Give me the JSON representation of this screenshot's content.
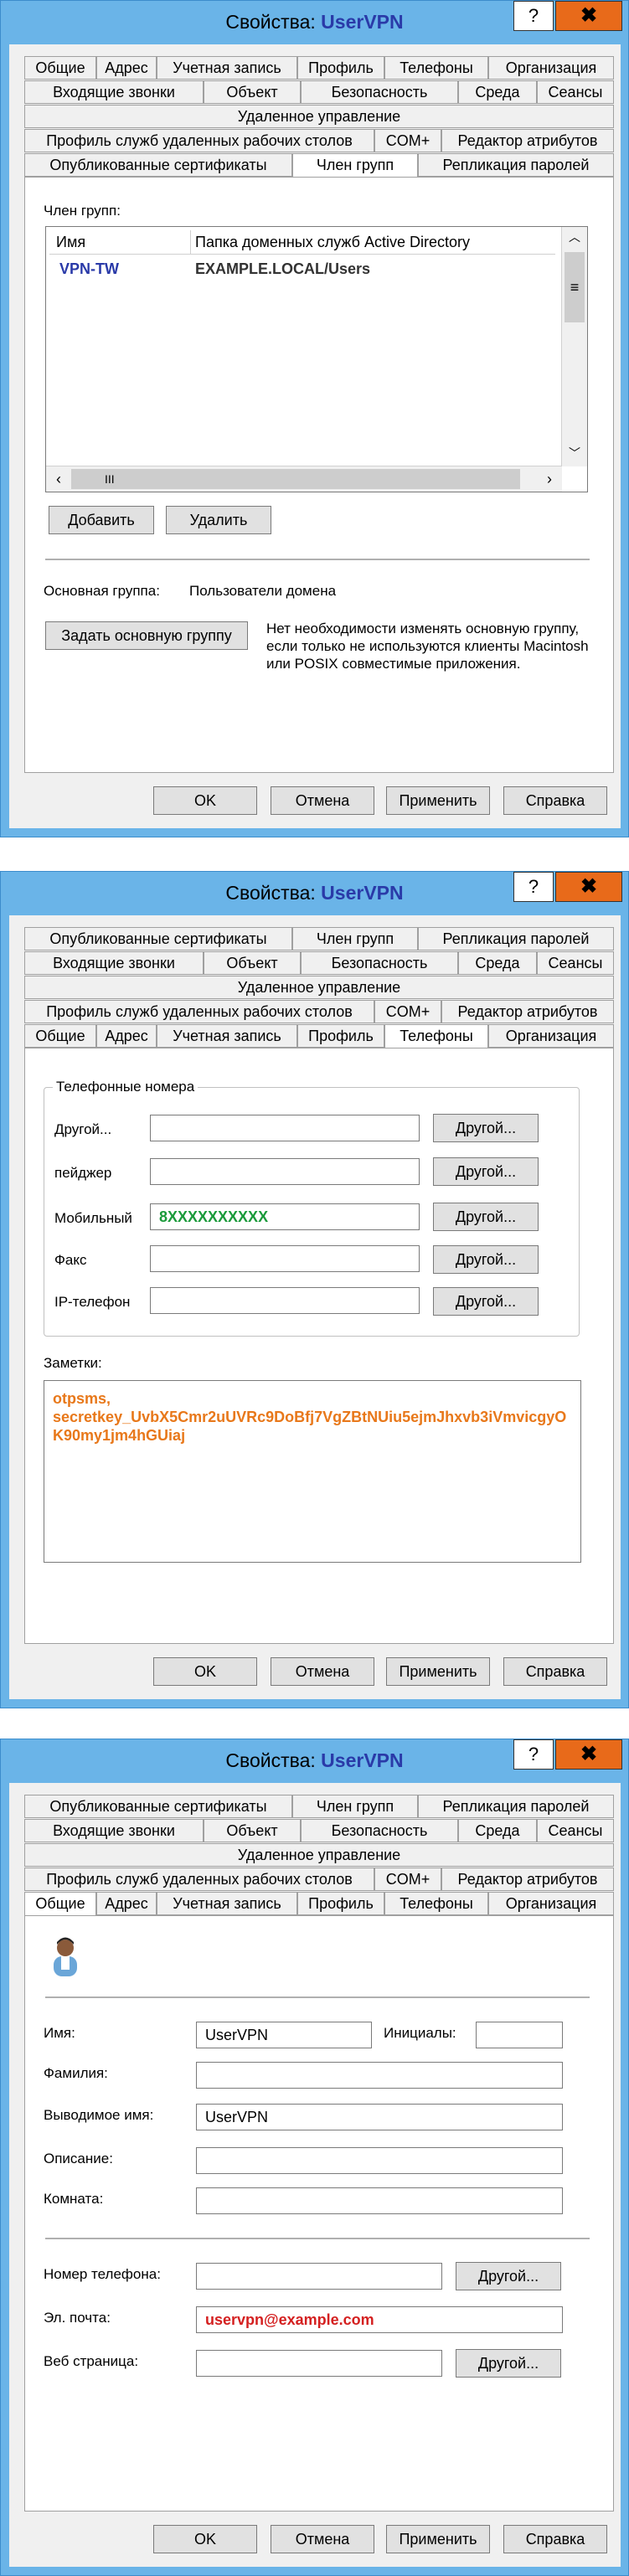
{
  "title_prefix": "Свойства:",
  "title_user": "UserVPN",
  "help_label": "?",
  "close_label": "✖",
  "tabs": {
    "obshchie": "Общие",
    "adres": "Адрес",
    "uchetnaya": "Учетная запись",
    "profil": "Профиль",
    "telefony": "Телефоны",
    "organizaciya": "Организация",
    "vhodyashchie": "Входящие звонки",
    "obekt": "Объект",
    "bezopasnost": "Безопасность",
    "sreda": "Среда",
    "seansy": "Сеансы",
    "udalennoe": "Удаленное управление",
    "profil_sluzhb": "Профиль служб удаленных рабочих столов",
    "com": "COM+",
    "redaktor": "Редактор атрибутов",
    "opublikovannye": "Опубликованные сертификаты",
    "chlen_grupp": "Член групп",
    "replikaciya": "Репликация паролей"
  },
  "footer": {
    "ok": "OK",
    "cancel": "Отмена",
    "apply": "Применить",
    "help": "Справка"
  },
  "groups": {
    "section_label": "Член групп:",
    "col_name": "Имя",
    "col_folder": "Папка доменных служб Active Directory",
    "rows": [
      {
        "name": "VPN-TW",
        "folder": "EXAMPLE.LOCAL/Users"
      }
    ],
    "hscroll_thumb": "III",
    "add_button": "Добавить",
    "remove_button": "Удалить",
    "primary_label": "Основная группа:",
    "primary_value": "Пользователи домена",
    "set_primary_button": "Задать основную группу",
    "note": "Нет необходимости изменять основную группу, если только не используются клиенты Macintosh или POSIX совместимые приложения.",
    "accent": "#2a3aa8"
  },
  "phones": {
    "group_title": "Телефонные номера",
    "other_button": "Другой...",
    "fields": [
      {
        "label": "Другой...",
        "value": ""
      },
      {
        "label": "пейджер",
        "value": ""
      },
      {
        "label": "Мобильный",
        "value": "8XXXXXXXXXX"
      },
      {
        "label": "Факс",
        "value": ""
      },
      {
        "label": "IP-телефон",
        "value": ""
      }
    ],
    "notes_label": "Заметки:",
    "notes_value": "otpsms,\nsecretkey_UvbX5Cmr2uUVRc9DoBfj7VgZBtNUiu5ejmJhxvb3iVmvicgyOK90my1jm4hGUiaj",
    "mobile_color": "#1a9a3a",
    "notes_color": "#e8781a"
  },
  "general": {
    "avatar_icon": "user-avatar-icon",
    "name_label": "Имя:",
    "name_value": "UserVPN",
    "initials_label": "Инициалы:",
    "initials_value": "",
    "surname_label": "Фамилия:",
    "surname_value": "",
    "display_label": "Выводимое имя:",
    "display_value": "UserVPN",
    "description_label": "Описание:",
    "description_value": "",
    "office_label": "Комната:",
    "office_value": "",
    "phone_label": "Номер телефона:",
    "phone_value": "",
    "email_label": "Эл. почта:",
    "email_value": "uservpn@example.com",
    "web_label": "Веб страница:",
    "web_value": "",
    "other_button": "Другой...",
    "email_color": "#d42020"
  }
}
